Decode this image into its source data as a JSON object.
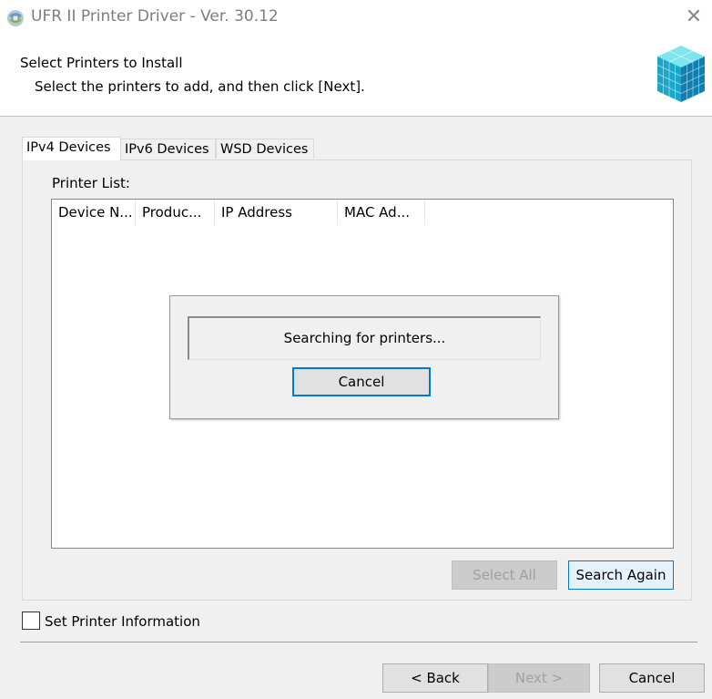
{
  "window": {
    "title": "UFR II Printer Driver - Ver. 30.12",
    "close_glyph": "✕"
  },
  "header": {
    "title": "Select Printers to Install",
    "subtitle": "Select the printers to add, and then click [Next]."
  },
  "tabs": [
    {
      "label": "IPv4 Devices",
      "active": true
    },
    {
      "label": "IPv6 Devices",
      "active": false
    },
    {
      "label": "WSD Devices",
      "active": false
    }
  ],
  "printer_list": {
    "label": "Printer List:",
    "columns": [
      "Device N...",
      "Produc...",
      "IP Address",
      "MAC Ad..."
    ],
    "rows": []
  },
  "search_dialog": {
    "status": "Searching for printers...",
    "cancel_label": "Cancel"
  },
  "list_buttons": {
    "select_all": "Select All",
    "search_again": "Search Again"
  },
  "set_printer_info": {
    "label": "Set Printer Information",
    "checked": false
  },
  "footer": {
    "back": "< Back",
    "next": "Next >",
    "cancel": "Cancel"
  },
  "icons": {
    "app": "printer-driver-icon",
    "logo": "cube-logo-icon",
    "close": "close-icon"
  },
  "colors": {
    "accent": "#0078d7",
    "dialog_bg": "#f0f0f0",
    "disabled_text": "#a0a0a0"
  }
}
